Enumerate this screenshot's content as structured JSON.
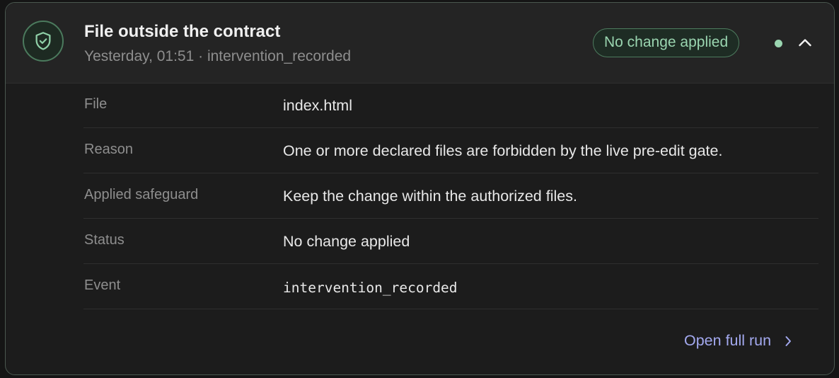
{
  "header": {
    "title": "File outside the contract",
    "subtitle": "Yesterday, 01:51 · intervention_recorded",
    "badge": "No change applied",
    "icon": "shield-check-icon",
    "accent_color": "#9ad5b0"
  },
  "details": [
    {
      "label": "File",
      "value": "index.html"
    },
    {
      "label": "Reason",
      "value": "One or more declared files are forbidden by the live pre-edit gate."
    },
    {
      "label": "Applied safeguard",
      "value": "Keep the change within the authorized files."
    },
    {
      "label": "Status",
      "value": "No change applied"
    },
    {
      "label": "Event",
      "value": "intervention_recorded"
    }
  ],
  "footer": {
    "link_label": "Open full run",
    "link_color": "#a3a9ef"
  }
}
